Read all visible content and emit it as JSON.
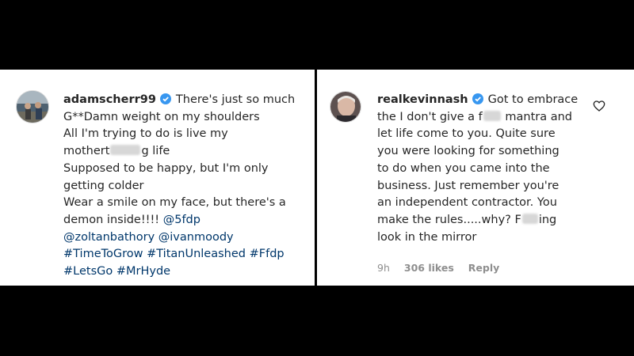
{
  "left_comment": {
    "username": "adamscherr99",
    "line1": "There's just so much",
    "line2": "G**Damn weight on my shoulders",
    "line3": "All I'm trying to do is live my",
    "line4_a": "mothert",
    "line4_b": "g life",
    "line5": "Supposed to be happy, but I'm only",
    "line6": "getting colder",
    "line7": "Wear a smile on my face, but there's a",
    "line8": "demon inside!!!!",
    "mention1": "@5fdp",
    "mention2": "@zoltanbathory",
    "mention3": "@ivanmoody",
    "hashtag1": "#TimeToGrow",
    "hashtag2": "#TitanUnleashed",
    "hashtag3": "#Ffdp",
    "hashtag4": "#LetsGo",
    "hashtag5": "#MrHyde"
  },
  "right_comment": {
    "username": "realkevinnash",
    "line1": "Got to embrace",
    "line2_a": "the I don't give a f",
    "line2_b": "mantra and",
    "line3": "let life come to you. Quite sure",
    "line4": "you were looking for something",
    "line5": "to do when you came into the",
    "line6": "business. Just remember you're",
    "line7": "an independent contractor. You",
    "line8": "make the rules.....why? F",
    "line8_b": "ing",
    "line9": "look in the mirror",
    "time": "9h",
    "likes": "306 likes",
    "reply": "Reply"
  },
  "icons": {
    "verified": "verified-badge-icon",
    "like": "heart-icon"
  },
  "colors": {
    "verified": "#3897f0",
    "hashtag": "#00376b",
    "meta": "#8e8e8e"
  }
}
